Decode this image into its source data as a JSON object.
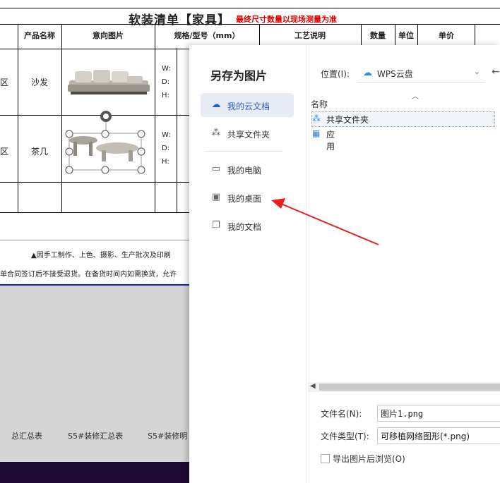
{
  "sheet": {
    "title": "软装清单【家具】",
    "title_note": "最终尺寸数量以现场测量为准",
    "headers": {
      "product": "产品名称",
      "image": "意向图片",
      "spec": "规格/型号（mm）",
      "craft": "工艺说明",
      "qty": "数量",
      "unit": "单位",
      "price": "单价"
    },
    "rows": [
      {
        "area": "区",
        "name": "沙发",
        "w": "W:",
        "d": "D:",
        "h": "H:"
      },
      {
        "area": "区",
        "name": "茶几",
        "w": "W:",
        "d": "D:",
        "h": "H:"
      }
    ],
    "footnote1": "▲因手工制作、上色、摄影、生产批次及印刷",
    "footnote2": "单合同签订后不接受退货。在备货时间内如需换货，允许",
    "tabs": [
      "总汇总表",
      "S5#装修汇总表",
      "S5#装修明"
    ]
  },
  "dialog": {
    "title": "另存为图片",
    "nav": [
      {
        "label": "我的云文档",
        "icon": "cloud-icon",
        "active": true
      },
      {
        "label": "共享文件夹",
        "icon": "share-icon",
        "active": false
      },
      {
        "label": "我的电脑",
        "icon": "computer-icon",
        "active": false
      },
      {
        "label": "我的桌面",
        "icon": "desktop-icon",
        "active": false
      },
      {
        "label": "我的文档",
        "icon": "documents-icon",
        "active": false
      }
    ],
    "location_label": "位置(I):",
    "location_value": "WPS云盘",
    "column_name": "名称",
    "files": [
      {
        "label": "共享文件夹",
        "icon": "shared-folder-icon"
      },
      {
        "label": "应用",
        "icon": "apps-icon"
      }
    ],
    "filename_label": "文件名(N):",
    "filename_value": "图片1.png",
    "filetype_label": "文件类型(T):",
    "filetype_value": "可移植网络图形(*.png)",
    "open_after_label": "导出图片后浏览(O)"
  },
  "colors": {
    "accent": "#2a5bd7",
    "arrow": "#e8201c",
    "note_red": "#e00000",
    "bottom_bar": "#1e0a34"
  }
}
